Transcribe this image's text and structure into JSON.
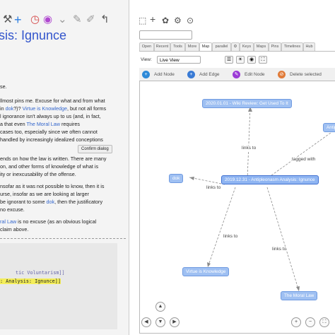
{
  "left_panel": {
    "toolbar_icons": [
      "hammer-icon",
      "plus-icon",
      "timer-icon",
      "eye-icon",
      "chevron-down-icon",
      "edit-icon",
      "edit-off-icon",
      "more-icon"
    ],
    "title": "sis: Ignunce",
    "paragraph_lines": [
      "se.",
      "",
      "llmost pins me. Excuse for what and from what",
      "in dok?)? Virtue is Knowledge, but not all forms",
      "l ignorance isn't always up to us (and, in fact,",
      "a that even The Moral Law requires",
      "cases too, especially since we often cannot",
      "handled by increasingly idealized conceptions",
      "",
      "ends on how the law is written. There are many",
      "on, and other forms of knowledge of what is",
      "ity or inexcusability of the offense.",
      "",
      "nsofar as it was not possible to know, then it is",
      "urse, insofar as we are looking at larger",
      "be ignorant to some dok, then the justificatory",
      "no excuse.",
      "",
      "ral Law is no excuse (as an obvious logical",
      "  claim above."
    ],
    "links": {
      "dok": "dok",
      "virtue": "Virtue is Knowledge",
      "moral_law": "The Moral Law",
      "moral_law_short": "ral Law"
    },
    "confirm_button": "Confirm dialog",
    "code_lines": [
      "tic Voluntarism]]",
      ": Analysis: Ignunce]]"
    ]
  },
  "right_panel": {
    "toolbar_icons": [
      "new-tiddler-icon",
      "plus-icon",
      "palette-icon",
      "gear-icon",
      "check-circle-icon"
    ],
    "search_placeholder": "",
    "tabs": [
      "Open",
      "Recent",
      "Tools",
      "More",
      "Map",
      "parallel",
      "⚙",
      "Keys",
      "Maps",
      "Pins",
      "Timelines",
      "Hub"
    ],
    "active_tab": "Map",
    "view_label": "View:",
    "view_value": "Live View",
    "actions": {
      "add_node": "Add Node",
      "add_edge": "Add Edge",
      "edit_node": "Edit Node",
      "delete_selected": "Delete selected"
    },
    "accent_colors": {
      "node_fill": "#9fc0f2",
      "node_border": "#6f9ae0",
      "add_node": "#2e8ad8",
      "add_edge": "#3a7bd5",
      "edit_node": "#9b3bd6",
      "delete": "#e07b39"
    }
  },
  "graph": {
    "nodes": {
      "review": "2020.01.01 - Wiki Review: Get Used To It",
      "antipleo_partial": "Antip",
      "dok": "dok",
      "center": "2019.12.31 - Antipleonasm Analysis: Ignunce",
      "virtue": "Virtue is Knowledge",
      "moral_law": "The Moral Law"
    },
    "edge_labels": {
      "e1": "links to",
      "e2": "tagged with",
      "e3": "links to",
      "e4": "links to",
      "e5": "links to"
    }
  },
  "nav_controls": [
    "up-arrow-icon",
    "left-arrow-icon",
    "down-arrow-icon",
    "right-arrow-icon",
    "zoom-in-icon",
    "zoom-out-icon",
    "fit-icon"
  ]
}
